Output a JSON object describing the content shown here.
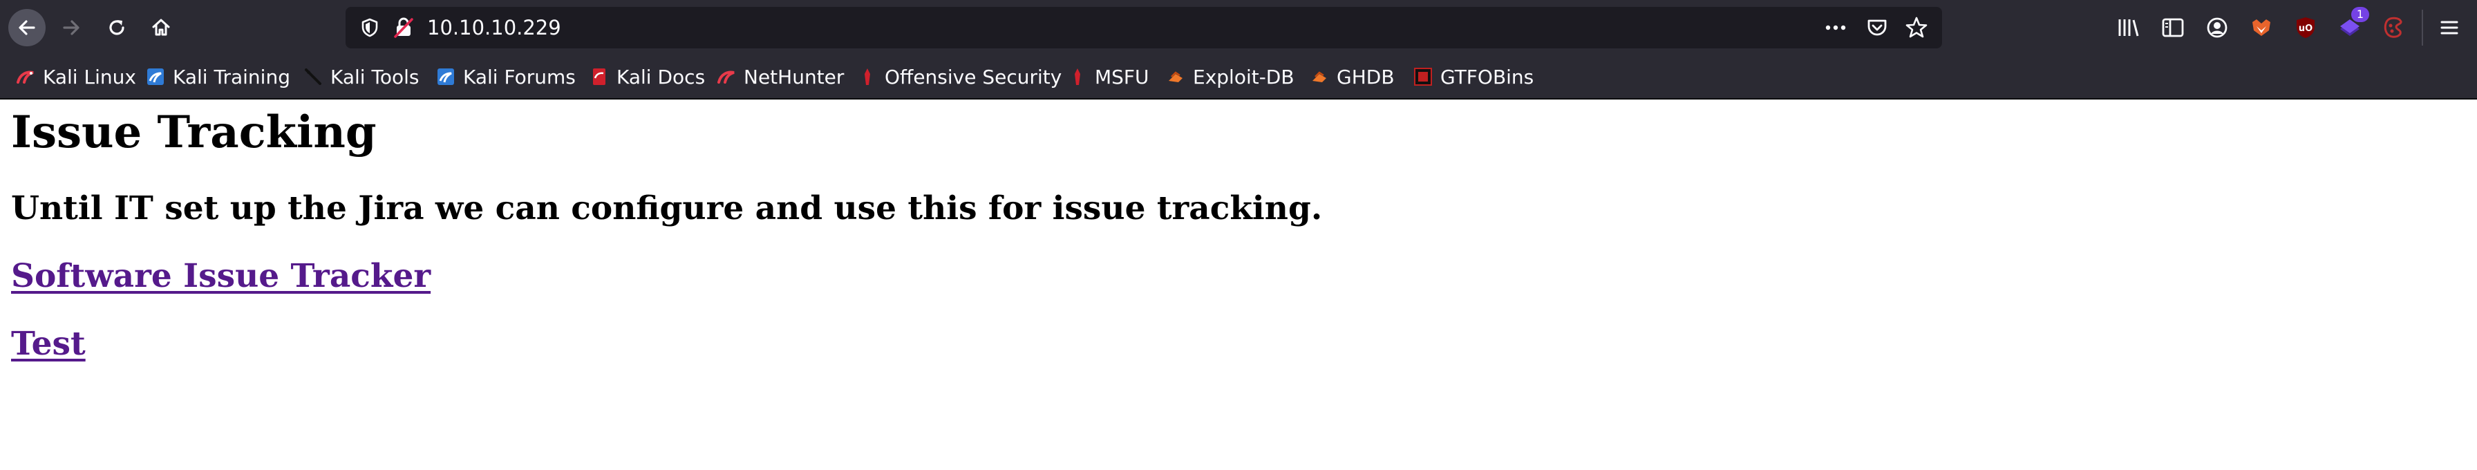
{
  "browser": {
    "address": {
      "url": "10.10.10.229"
    },
    "badges": {
      "extension_count": "1"
    },
    "bookmarks": [
      {
        "label": "Kali Linux",
        "icon": "kali-dragon-icon"
      },
      {
        "label": "Kali Training",
        "icon": "kali-training-icon"
      },
      {
        "label": "Kali Tools",
        "icon": "kali-tools-icon"
      },
      {
        "label": "Kali Forums",
        "icon": "kali-forums-icon"
      },
      {
        "label": "Kali Docs",
        "icon": "kali-docs-icon"
      },
      {
        "label": "NetHunter",
        "icon": "nethunter-icon"
      },
      {
        "label": "Offensive Security",
        "icon": "offsec-icon"
      },
      {
        "label": "MSFU",
        "icon": "msfu-icon"
      },
      {
        "label": "Exploit-DB",
        "icon": "exploit-db-icon"
      },
      {
        "label": "GHDB",
        "icon": "ghdb-icon"
      },
      {
        "label": "GTFOBins",
        "icon": "gtfobins-icon"
      }
    ],
    "colors": {
      "chrome_bg": "#2b2a33",
      "urlbar_bg": "#1c1b22",
      "text": "#fbfbfe",
      "visited_link": "#551a8b"
    }
  },
  "page": {
    "title": "Issue Tracking",
    "subtitle": "Until IT set up the Jira we can configure and use this for issue tracking.",
    "links": [
      {
        "label": "Software Issue Tracker"
      },
      {
        "label": "Test"
      }
    ]
  }
}
